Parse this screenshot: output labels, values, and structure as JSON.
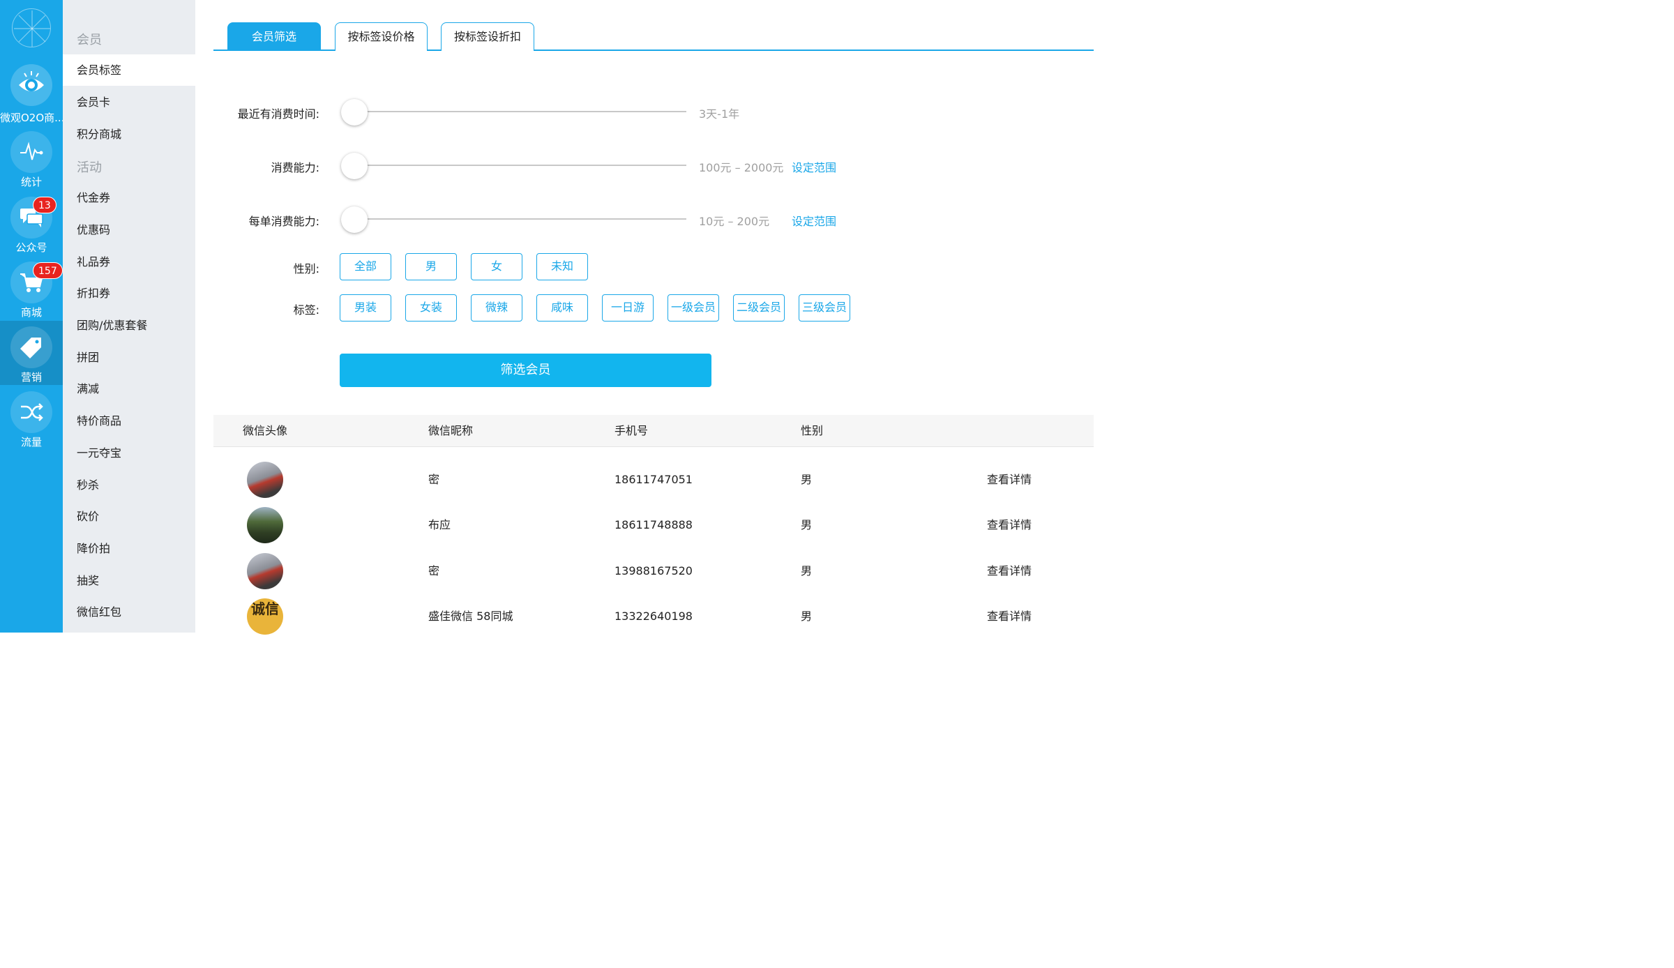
{
  "rail": {
    "items": [
      {
        "label": "微观O2O商...",
        "icon": "eye-icon"
      },
      {
        "label": "统计",
        "icon": "pulse-icon"
      },
      {
        "label": "公众号",
        "icon": "chat-icon",
        "badge": "13"
      },
      {
        "label": "商城",
        "icon": "cart-icon",
        "badge": "157"
      },
      {
        "label": "营销",
        "icon": "tag-icon"
      },
      {
        "label": "流量",
        "icon": "shuffle-icon"
      }
    ]
  },
  "menu": {
    "group_member": "会员",
    "group_activity": "活动",
    "member_items": [
      "会员标签",
      "会员卡",
      "积分商城"
    ],
    "activity_items": [
      "代金券",
      "优惠码",
      "礼品券",
      "折扣券",
      "团购/优惠套餐",
      "拼团",
      "满减",
      "特价商品",
      "一元夺宝",
      "秒杀",
      "砍价",
      "降价拍",
      "抽奖",
      "微信红包"
    ]
  },
  "tabs": [
    "会员筛选",
    "按标签设价格",
    "按标签设折扣"
  ],
  "filters": {
    "recent_label": "最近有消费时间:",
    "recent_range": "3天-1年",
    "spend_label": "消费能力:",
    "spend_range": "100元 – 2000元",
    "spend_link": "设定范围",
    "per_order_label": "每单消费能力:",
    "per_order_range": "10元 – 200元",
    "per_order_link": "设定范围",
    "gender_label": "性别:",
    "gender_options": [
      "全部",
      "男",
      "女",
      "未知"
    ],
    "tag_label": "标签:",
    "tag_options": [
      "男装",
      "女装",
      "微辣",
      "咸味",
      "一日游",
      "一级会员",
      "二级会员",
      "三级会员"
    ],
    "submit": "筛选会员"
  },
  "table": {
    "headers": [
      "微信头像",
      "微信昵称",
      "手机号",
      "性别"
    ],
    "rows": [
      {
        "nickname": "密",
        "phone": "18611747051",
        "gender": "男",
        "action": "查看详情"
      },
      {
        "nickname": "布应",
        "phone": "18611748888",
        "gender": "男",
        "action": "查看详情"
      },
      {
        "nickname": "密",
        "phone": "13988167520",
        "gender": "男",
        "action": "查看详情"
      },
      {
        "nickname": "盛佳微信 58同城",
        "phone": "13322640198",
        "gender": "男",
        "action": "查看详情"
      }
    ],
    "avatar_glyphs": "诚信"
  },
  "colors": {
    "accent": "#1aa7e8",
    "rail": "#1aa7e8",
    "menu_bg": "#eaedf1",
    "badge": "#e8231f"
  }
}
